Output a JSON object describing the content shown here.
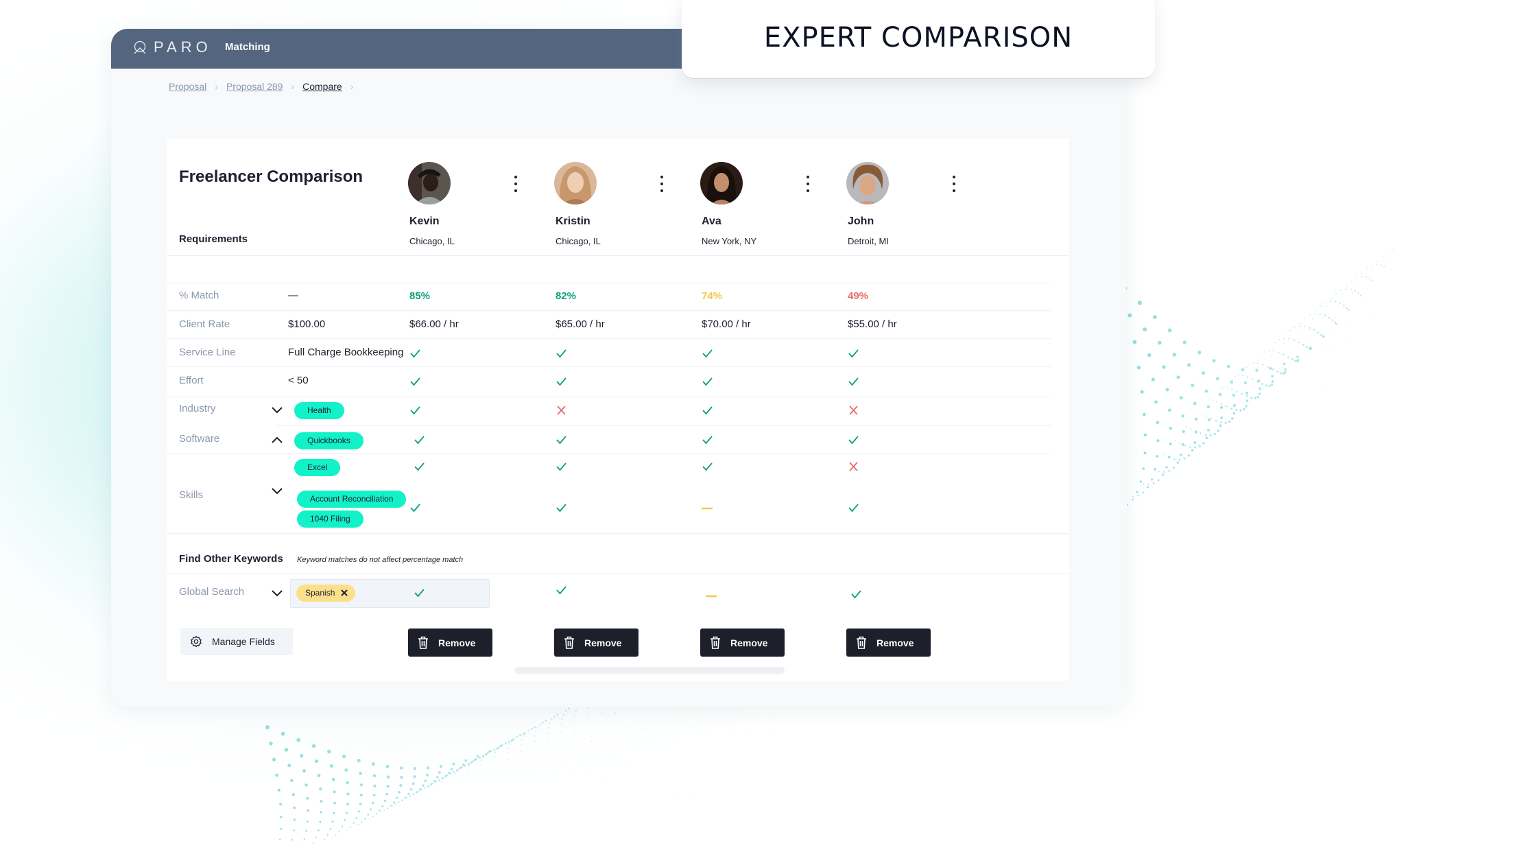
{
  "badge": {
    "title": "EXPERT COMPARISON"
  },
  "app": {
    "brand": "PARO",
    "nav_item": "Matching"
  },
  "breadcrumb": [
    {
      "label": "Proposal"
    },
    {
      "label": "Proposal 289"
    },
    {
      "label": "Compare"
    }
  ],
  "comparison": {
    "title": "Freelancer Comparison",
    "requirements_heading": "Requirements",
    "freelancers": [
      {
        "name": "Kevin",
        "location": "Chicago, IL",
        "match": "85%",
        "match_color": "#0e9f7a",
        "rate": "$66.00 / hr"
      },
      {
        "name": "Kristin",
        "location": "Chicago, IL",
        "match": "82%",
        "match_color": "#0e9f7a",
        "rate": "$65.00 / hr"
      },
      {
        "name": "Ava",
        "location": "New York, NY",
        "match": "74%",
        "match_color": "#f2c94c",
        "rate": "$70.00 / hr"
      },
      {
        "name": "John",
        "location": "Detroit, MI",
        "match": "49%",
        "match_color": "#eb6b6b",
        "rate": "$55.00 / hr"
      }
    ],
    "rows": [
      {
        "label": "% Match",
        "value": "—"
      },
      {
        "label": "Client Rate",
        "value": "$100.00"
      },
      {
        "label": "Service Line",
        "value": "Full Charge Bookkeeping",
        "marks": [
          "check",
          "check",
          "check",
          "check"
        ]
      },
      {
        "label": "Effort",
        "value": "< 50",
        "marks": [
          "check",
          "check",
          "check",
          "check"
        ]
      },
      {
        "label": "Industry",
        "expanded": false,
        "tags": [
          "Health"
        ],
        "marks": [
          "check",
          "cross",
          "check",
          "cross"
        ]
      },
      {
        "label": "Software",
        "expanded": true,
        "tags": [
          "Quickbooks",
          "Excel"
        ],
        "marks_by_tag": [
          [
            "check",
            "check",
            "check",
            "check"
          ],
          [
            "check",
            "check",
            "check",
            "cross"
          ]
        ]
      },
      {
        "label": "Skills",
        "expanded": false,
        "tags": [
          "Account Reconciliation",
          "1040 Filing"
        ],
        "marks": [
          "check",
          "check",
          "partial",
          "check"
        ]
      }
    ],
    "keywords": {
      "title": "Find Other Keywords",
      "note": "Keyword matches do not affect percentage match",
      "row_label": "Global Search",
      "tags": [
        "Spanish"
      ],
      "marks": [
        "check",
        "check",
        "partial",
        "check"
      ]
    },
    "manage_fields_label": "Manage Fields",
    "remove_label": "Remove"
  },
  "colors": {
    "check": "#0e9f7a",
    "cross": "#eb6b6b",
    "partial": "#f2c94c",
    "pill": "#12f1c8",
    "tag": "#fbe08c",
    "topbar": "#546580"
  }
}
